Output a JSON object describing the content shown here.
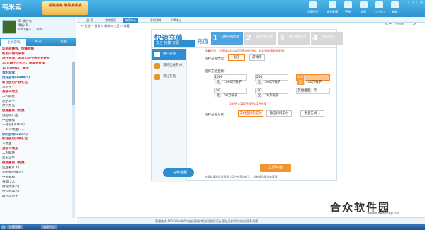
{
  "app": {
    "logo": "有米云",
    "banner": "某某某某\n某某某某某"
  },
  "toolbar": [
    {
      "label": "切换帐号"
    },
    {
      "label": "联系客服"
    },
    {
      "label": "更新"
    },
    {
      "label": "充值"
    },
    {
      "label": "个人中心"
    },
    {
      "label": "邮箱"
    }
  ],
  "window_controls": {
    "min": "–",
    "max": "□",
    "close": "×"
  },
  "pill": {
    "line1": "免费游戏",
    "line2": "免费玩"
  },
  "user": {
    "line1": "ID: 用户名",
    "line2": "等级: 5",
    "line3": "0.00 金币 / 12345"
  },
  "left_tabs": [
    {
      "label": "主场游戏"
    },
    {
      "label": "好友"
    },
    {
      "label": "设置"
    }
  ],
  "left_list": [
    {
      "text": "玩奇益赚钱，你赚我赚",
      "hot": true
    },
    {
      "text": "新用户福利来袭",
      "hot": true
    },
    {
      "text": "现在充值，游戏币送不停更多好礼",
      "hot": true
    },
    {
      "text": "50元赠千元礼包，速度免费领",
      "hot": true
    },
    {
      "text": "10元够我玩个痛快",
      "hot": true
    },
    {
      "text": "我的游戏",
      "hot": false,
      "blue": true
    },
    {
      "text": "推荐游戏(1499人)",
      "hot": false,
      "blue": true
    },
    {
      "text": "新注册用户领礼包",
      "hot": true
    },
    {
      "text": "斗地主",
      "hot": false
    },
    {
      "text": "高级斗地主",
      "hot": true
    },
    {
      "text": "二人麻将",
      "hot": false
    },
    {
      "text": "欢乐斗牛",
      "hot": false
    },
    {
      "text": "德州扑克",
      "hot": false
    },
    {
      "text": "掼蛋赢钱（免费）",
      "hot": true
    },
    {
      "text": "捕鱼欢乐送",
      "hot": false
    },
    {
      "text": "中国象棋",
      "hot": false
    },
    {
      "text": "千变双扣(26人)",
      "hot": false
    },
    {
      "text": "二人斗地主(2人)",
      "hot": false
    },
    {
      "text": "休闲游戏(317人)",
      "hot": false,
      "blue": true
    },
    {
      "text": "新注册用户领礼包",
      "hot": true
    },
    {
      "text": "斗地主",
      "hot": false
    },
    {
      "text": "高级斗地主",
      "hot": true
    },
    {
      "text": "二人麻将",
      "hot": false
    },
    {
      "text": "欢乐斗牛",
      "hot": false
    },
    {
      "text": "掼蛋赢钱（免费）",
      "hot": true
    },
    {
      "text": "连连看(1人)",
      "hot": false
    },
    {
      "text": "休闲捕鱼(8人)",
      "hot": false
    },
    {
      "text": "中国象棋",
      "hot": false
    },
    {
      "text": "升级(2人)",
      "hot": false
    },
    {
      "text": "跑得快(1人)",
      "hot": false
    },
    {
      "text": "拖拉机(2人)",
      "hot": false
    },
    {
      "text": "四人斗地主",
      "hot": false
    }
  ],
  "tabs": [
    {
      "label": "主 页"
    },
    {
      "label": "游戏首页"
    },
    {
      "label": "充值中心",
      "selected": true
    },
    {
      "label": "手机游戏"
    },
    {
      "label": "VIP中心"
    }
  ],
  "subbar": "← 后退   → 前进   ↻ 刷新   ⌂ 主页   ☆ 收藏",
  "panel": {
    "title": "快速充值",
    "badge": "安全 快捷 方便",
    "title2": "充值",
    "steps": [
      {
        "n": "1",
        "t": "选择充值方式"
      },
      {
        "n": "2",
        "t": "填写充值金额"
      },
      {
        "n": "3",
        "t": "确认充值信息"
      },
      {
        "n": "4",
        "t": "充值成功"
      }
    ],
    "notice": "温馨提示：充值成功后游戏币将自动到账，若未到账请联系客服。",
    "nav": [
      {
        "label": "账户充值",
        "on": true
      },
      {
        "label": "我的优惠券(0)"
      },
      {
        "label": "积分充值"
      }
    ],
    "cloud": "在线客服",
    "type_label": "选择充值类型：",
    "type_options": [
      {
        "label": "银子",
        "sel": true
      },
      {
        "label": "游戏币"
      }
    ],
    "amount_label": "选择充值金额：",
    "amounts": [
      {
        "n": "1000元",
        "v": "1000万银子"
      },
      {
        "n": "500元",
        "v": "500万银子"
      },
      {
        "n": "100元",
        "v": "100万银子",
        "sel": true
      },
      {
        "n": "50元",
        "v": "50万银子"
      },
      {
        "n": "20元",
        "v": "20万银子"
      },
      {
        "n": "其他金额",
        "v": "元"
      }
    ],
    "tip": "100元=100万银子=1元充值",
    "pay_label": "选择充值方式：",
    "pay_options": [
      {
        "label": "支付宝扫码支付",
        "sel": true
      },
      {
        "label": "微信扫码支付"
      },
      {
        "label": "更多方式 ⌄"
      }
    ],
    "button": "立即充值",
    "agree": "充值前请阅读并同意《用户充值协议》，如有疑问请咨询客服"
  },
  "footer": "客服热线 400-000-0000   在线客服   常见问题   防沉迷   家长监护   用户协议   隐私政策",
  "taskbar": [
    {
      "label": "快速登录"
    },
    {
      "label": "游戏中心"
    }
  ],
  "watermark": "合众软件园",
  "watermark_url": "www.hezhong.net"
}
